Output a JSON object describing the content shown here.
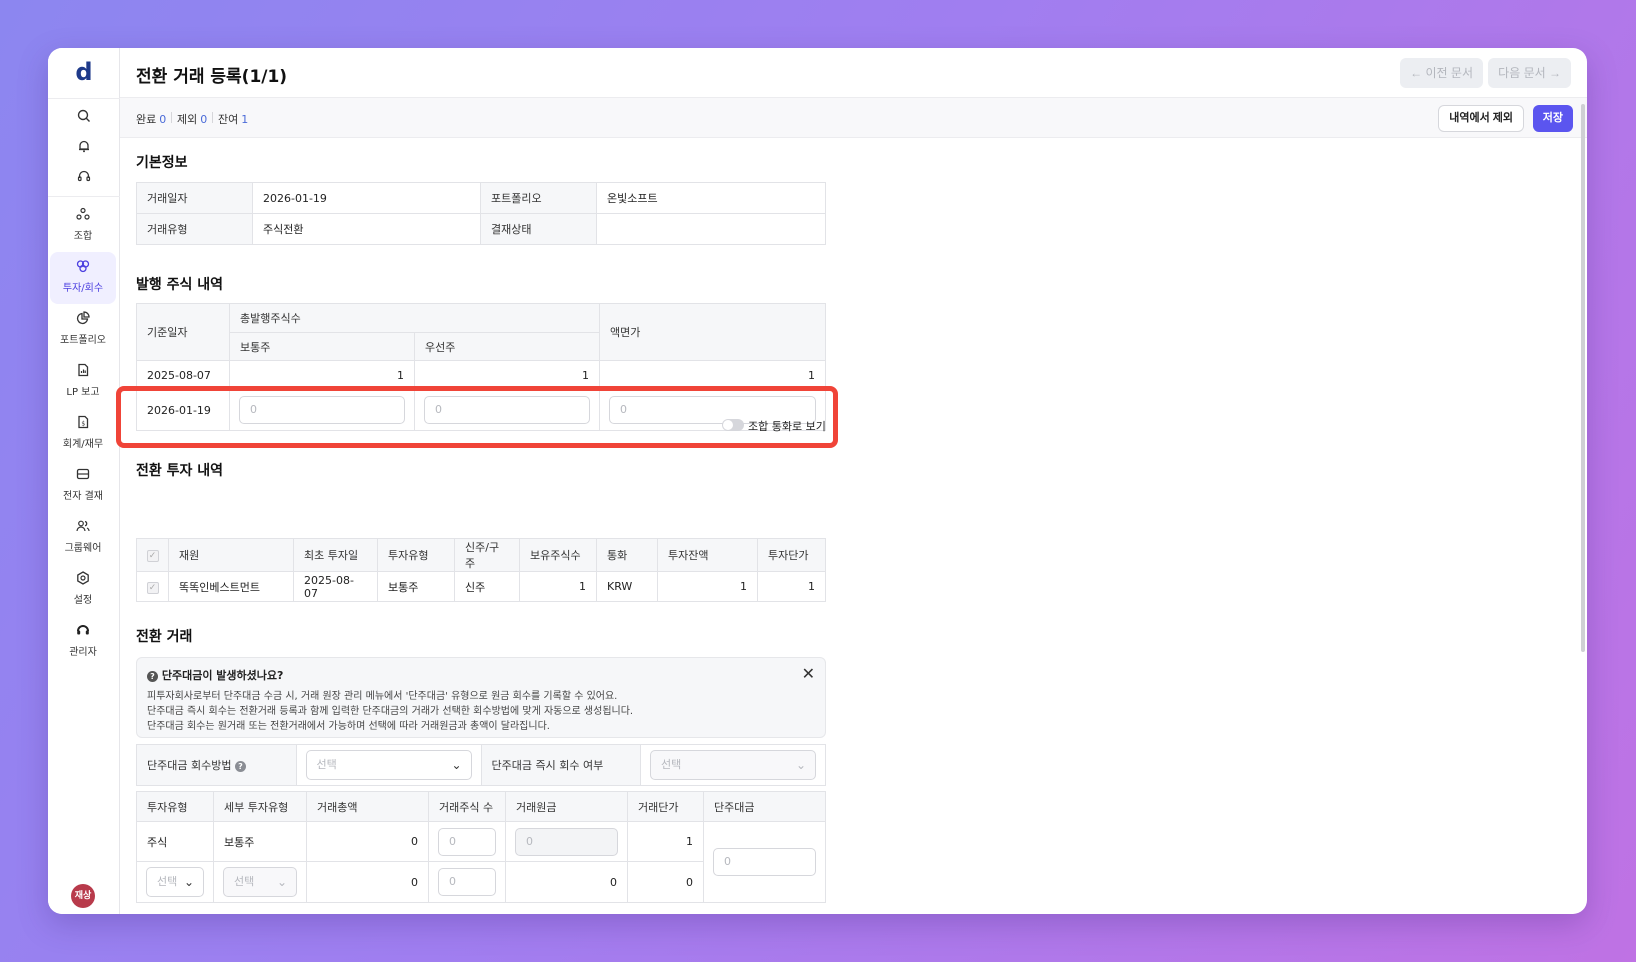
{
  "app": {
    "logo": "d"
  },
  "sidebar": {
    "items": [
      {
        "label": "조합"
      },
      {
        "label": "투자/회수"
      },
      {
        "label": "포트폴리오"
      },
      {
        "label": "LP 보고"
      },
      {
        "label": "회계/재무"
      },
      {
        "label": "전자 결재"
      },
      {
        "label": "그룹웨어"
      },
      {
        "label": "설정"
      },
      {
        "label": "관리자"
      }
    ],
    "active": "투자/회수",
    "user_initials": "재상"
  },
  "header": {
    "title": "전환 거래 등록(1/1)",
    "prev_label": "이전 문서",
    "next_label": "다음 문서"
  },
  "subbar": {
    "done_label": "완료",
    "done_count": "0",
    "excluded_label": "제외",
    "excluded_count": "0",
    "remaining_label": "잔여",
    "remaining_count": "1",
    "exclude_button": "내역에서 제외",
    "save_button": "저장"
  },
  "basic_info": {
    "title": "기본정보",
    "trade_date_label": "거래일자",
    "trade_date": "2026-01-19",
    "portfolio_label": "포트폴리오",
    "portfolio": "온빛소프트",
    "trade_type_label": "거래유형",
    "trade_type": "주식전환",
    "approval_label": "결재상태",
    "approval": ""
  },
  "issued_shares": {
    "title": "발행 주식 내역",
    "headers": {
      "base_date": "기준일자",
      "total_shares": "총발행주식수",
      "common": "보통주",
      "preferred": "우선주",
      "par_value": "액면가"
    },
    "rows": [
      {
        "date": "2025-08-07",
        "common": "1",
        "preferred": "1",
        "par": "1"
      }
    ],
    "new_row": {
      "date": "2026-01-19",
      "placeholder": "0"
    }
  },
  "conversion_investment": {
    "title": "전환 투자 내역",
    "toggle_label": "조합 통화로 보기",
    "headers": [
      "재원",
      "최초 투자일",
      "투자유형",
      "신주/구주",
      "보유주식수",
      "통화",
      "투자잔액",
      "투자단가"
    ],
    "rows": [
      {
        "source": "똑똑인베스트먼트",
        "first_date": "2025-08-07",
        "type": "보통주",
        "new_old": "신주",
        "shares": "1",
        "currency": "KRW",
        "balance": "1",
        "unit_price": "1"
      }
    ]
  },
  "conversion_trade": {
    "title": "전환 거래",
    "notice": {
      "title": "단주대금이 발생하셨나요?",
      "lines": [
        "피투자회사로부터 단주대금 수금 시, 거래 원장 관리 메뉴에서 '단주대금' 유형으로 원금 회수를 기록할 수 있어요.",
        "단주대금 즉시 회수는 전환거래 등록과 함께 입력한 단주대금의 거래가 선택한 회수방법에 맞게 자동으로 생성됩니다.",
        "단주대금 회수는 원거래 또는 전환거래에서 가능하며 선택에 따라 거래원금과 총액이 달라집니다."
      ]
    },
    "recovery_method_label": "단주대금 회수방법",
    "recovery_method_placeholder": "선택",
    "immediate_label": "단주대금 즉시 회수 여부",
    "immediate_placeholder": "선택",
    "headers": [
      "투자유형",
      "세부 투자유형",
      "거래총액",
      "거래주식 수",
      "거래원금",
      "거래단가",
      "단주대금"
    ],
    "row1": {
      "type": "주식",
      "subtype": "보통주",
      "total": "0",
      "shares_ph": "0",
      "principal_ph": "0",
      "unit": "1"
    },
    "row2": {
      "type_ph": "선택",
      "subtype_ph": "선택",
      "total": "0",
      "shares_ph": "0",
      "principal": "0",
      "unit": "0"
    },
    "fraction_ph": "0"
  }
}
